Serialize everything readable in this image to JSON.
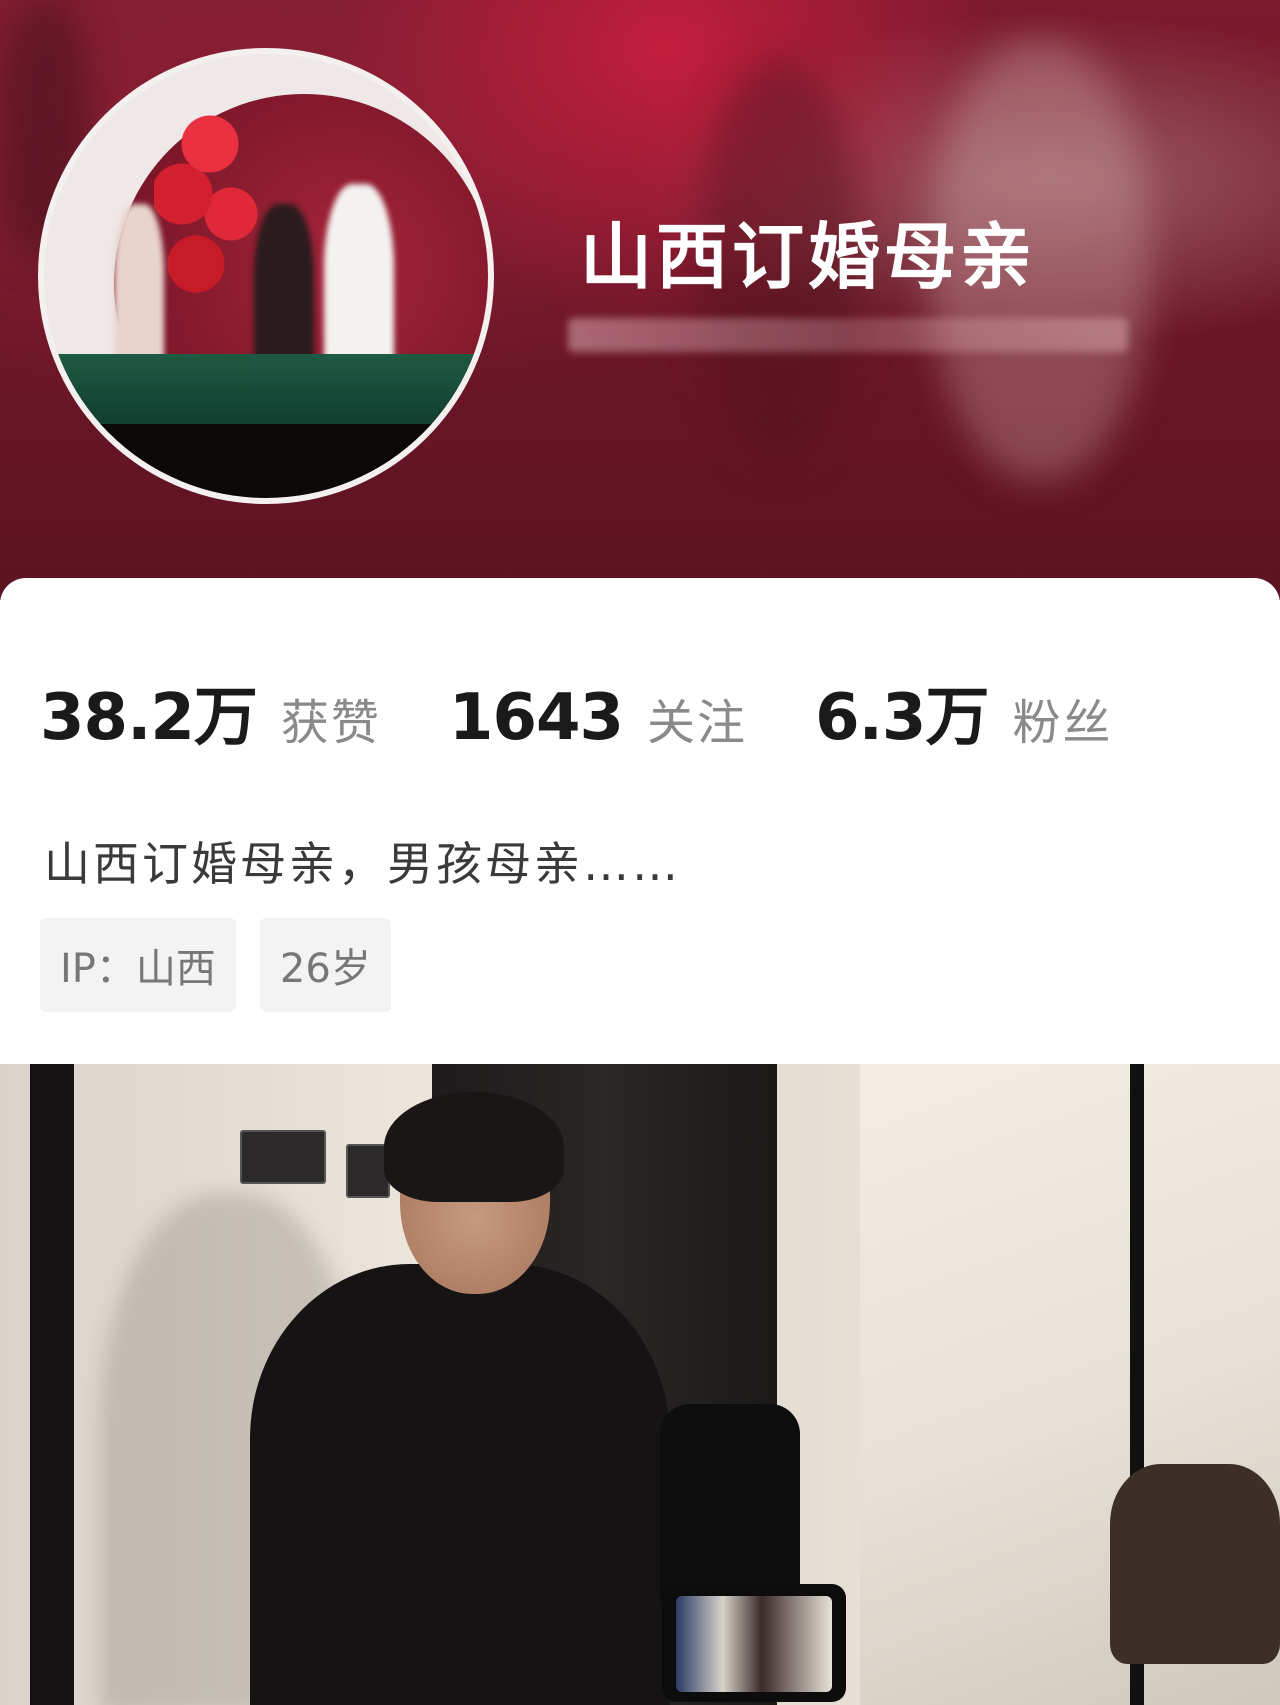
{
  "profile": {
    "nickname": "山西订婚母亲",
    "stats": [
      {
        "value": "38.2万",
        "label": "获赞"
      },
      {
        "value": "1643",
        "label": "关注"
      },
      {
        "value": "6.3万",
        "label": "粉丝"
      }
    ],
    "bio": "山西订婚母亲，男孩母亲……",
    "tags": [
      "IP：山西",
      "26岁"
    ]
  },
  "colors": {
    "header_bg": "#6b1627",
    "nickname_text": "#ffffff",
    "stat_number": "#1a1a1a",
    "stat_label": "#8a8a8a",
    "tag_bg": "#f3f3f3"
  }
}
